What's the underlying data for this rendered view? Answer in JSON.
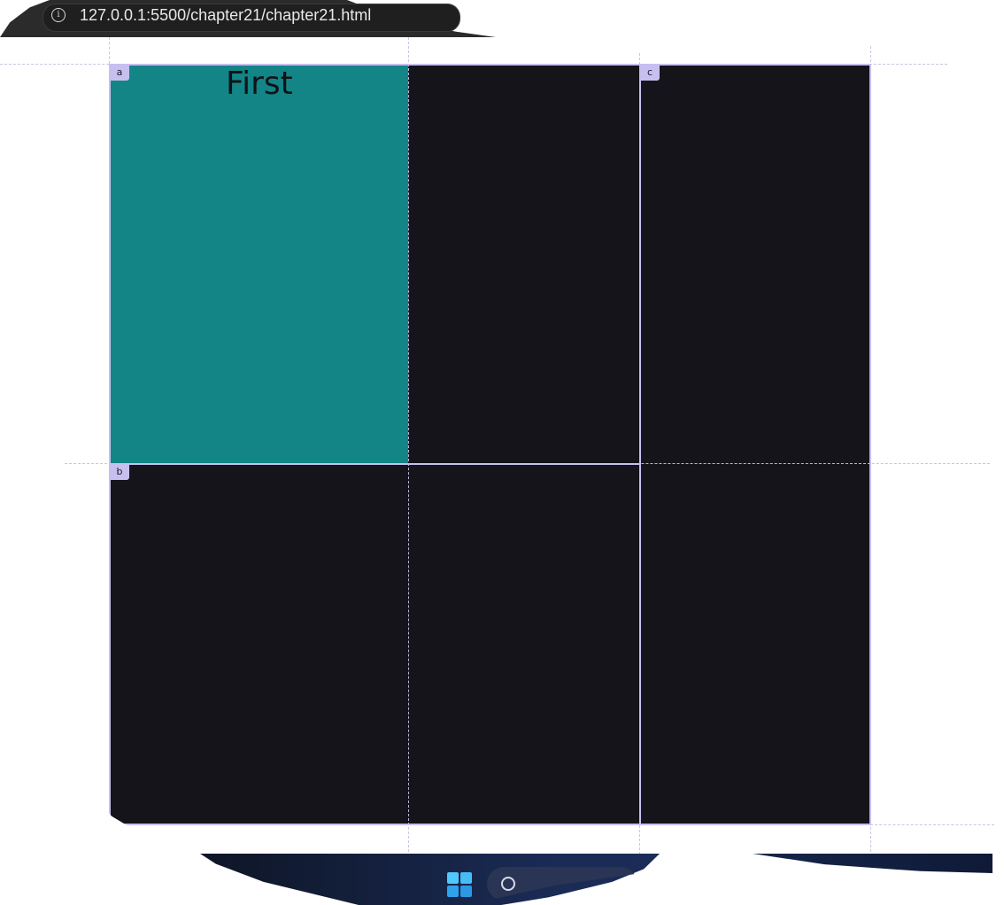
{
  "browser": {
    "url": "127.0.0.1:5500/chapter21/chapter21.html",
    "info_icon": "info-icon",
    "info_glyph": "i"
  },
  "grid": {
    "first_item_label": "First",
    "first_item_color": "#138587",
    "background_color": "#15141a",
    "overlay_color": "#c7bff0",
    "area_badges": {
      "a": "a",
      "b": "b",
      "c": "c"
    }
  },
  "taskbar": {
    "start_icon": "windows-start-icon",
    "search_icon": "search-icon"
  }
}
